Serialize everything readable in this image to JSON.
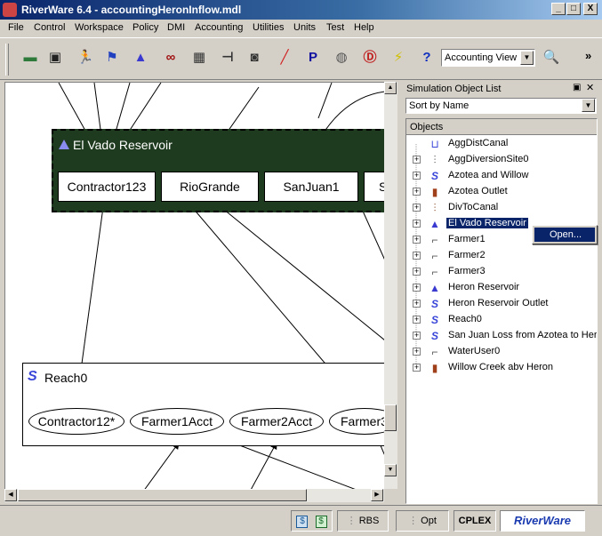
{
  "window": {
    "title": "RiverWare 6.4 - accountingHeronInflow.mdl",
    "controls": [
      "_",
      "□",
      "X"
    ]
  },
  "menu": [
    "File",
    "Control",
    "Workspace",
    "Policy",
    "DMI",
    "Accounting",
    "Utilities",
    "Units",
    "Test",
    "Help"
  ],
  "toolbar": {
    "buttons": [
      {
        "name": "open-book-icon",
        "glyph": "▬",
        "color": "#2d7a3a"
      },
      {
        "name": "save-disk-icon",
        "glyph": "▣",
        "color": "#222"
      },
      {
        "name": "run-figure-icon",
        "glyph": "🏃",
        "color": "#c03020"
      },
      {
        "name": "multi-run-icon",
        "glyph": "⚑",
        "color": "#2040c0"
      },
      {
        "name": "triangle-object-icon",
        "glyph": "▲",
        "color": "#3a3ad0"
      },
      {
        "name": "link-icon",
        "glyph": "∞",
        "color": "#a01010"
      },
      {
        "name": "grid-table-icon",
        "glyph": "▦",
        "color": "#333"
      },
      {
        "name": "input-icon",
        "glyph": "⊣",
        "color": "#333"
      },
      {
        "name": "camera-icon",
        "glyph": "◙",
        "color": "#333"
      },
      {
        "name": "plot-icon",
        "glyph": "╱",
        "color": "#d02020"
      },
      {
        "name": "policy-p-icon",
        "glyph": "P",
        "color": "#1010a0"
      },
      {
        "name": "database-icon",
        "glyph": "◍",
        "color": "#555"
      },
      {
        "name": "diagnostics-d-icon",
        "glyph": "Ⓓ",
        "color": "#c02020"
      },
      {
        "name": "lightning-icon",
        "glyph": "⚡",
        "color": "#d0c000"
      },
      {
        "name": "help-question-icon",
        "glyph": "?",
        "color": "#1030c0"
      }
    ],
    "view_select": "Accounting View",
    "overflow": "»"
  },
  "workspace": {
    "elvado": {
      "title": "El Vado Reservoir",
      "accounts": [
        "Contractor123",
        "RioGrande",
        "SanJuan1",
        "S"
      ]
    },
    "reach0": {
      "title": "Reach0",
      "accounts": [
        "Contractor12*",
        "Farmer1Acct",
        "Farmer2Acct",
        "Farmer3"
      ]
    }
  },
  "sim_panel": {
    "title": "Simulation Object List",
    "sort": "Sort by Name",
    "column": "Objects",
    "items": [
      {
        "label": "AggDistCanal",
        "icon": "canal",
        "expand": false,
        "color": "#3a46d8"
      },
      {
        "label": "AggDiversionSite0",
        "icon": "diversion",
        "expand": true,
        "color": "#555"
      },
      {
        "label": "Azotea and Willow",
        "icon": "reach",
        "expand": true,
        "color": "#3a46d8"
      },
      {
        "label": "Azotea Outlet",
        "icon": "gauge",
        "expand": true,
        "color": "#a0401a"
      },
      {
        "label": "DivToCanal",
        "icon": "diversion",
        "expand": true,
        "color": "#8a4a2a"
      },
      {
        "label": "El Vado Reservoir",
        "icon": "reservoir",
        "expand": true,
        "color": "#3a3ad0",
        "selected": true
      },
      {
        "label": "Farmer1",
        "icon": "water-user",
        "expand": true,
        "color": "#555"
      },
      {
        "label": "Farmer2",
        "icon": "water-user",
        "expand": true,
        "color": "#555"
      },
      {
        "label": "Farmer3",
        "icon": "water-user",
        "expand": true,
        "color": "#555"
      },
      {
        "label": "Heron Reservoir",
        "icon": "reservoir",
        "expand": true,
        "color": "#3a3ad0"
      },
      {
        "label": "Heron Reservoir Outlet",
        "icon": "reach",
        "expand": true,
        "color": "#3a46d8"
      },
      {
        "label": "Reach0",
        "icon": "reach",
        "expand": true,
        "color": "#3a46d8"
      },
      {
        "label": "San Juan Loss from Azotea to Heron",
        "icon": "reach",
        "expand": true,
        "color": "#3a46d8"
      },
      {
        "label": "WaterUser0",
        "icon": "water-user",
        "expand": true,
        "color": "#555"
      },
      {
        "label": "Willow Creek abv Heron",
        "icon": "gauge",
        "expand": true,
        "color": "#a0401a"
      }
    ],
    "context_menu": [
      "Open..."
    ]
  },
  "status": {
    "rbs": "RBS",
    "opt": "Opt",
    "cplex": "CPLEX",
    "logo": "RiverWare"
  }
}
